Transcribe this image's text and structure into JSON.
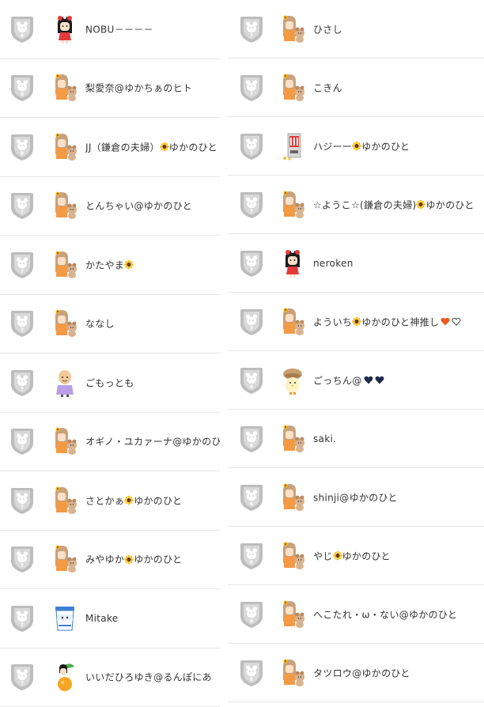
{
  "colors": {
    "badge": "#bdbdbd",
    "badge_inner": "#d9d9d9",
    "divider": "#e6e6e6",
    "text": "#333333",
    "heart_orange": "#ee5a1e",
    "heart_navy": "#1f2a4a"
  },
  "left": [
    {
      "badge": "8",
      "avatar": "girl-red-bow-avatar",
      "name": "NOBU－－－－",
      "suffix": []
    },
    {
      "badge": "8",
      "avatar": "girl-with-dog-avatar",
      "name": "梨愛奈@ゆかちぁのヒト",
      "suffix": []
    },
    {
      "badge": "8",
      "avatar": "girl-with-dog-avatar",
      "name": "JJ（鎌倉の夫婦）",
      "suffix": [
        "sunflower-icon"
      ],
      "name_after": "ゆかのひと"
    },
    {
      "badge": "7",
      "avatar": "girl-with-dog-avatar",
      "name": "とんちゃい@ゆかのひと",
      "suffix": []
    },
    {
      "badge": "7",
      "avatar": "girl-with-dog-avatar",
      "name": "かたやま",
      "suffix": [
        "sunflower-icon"
      ]
    },
    {
      "badge": "7",
      "avatar": "girl-with-dog-avatar",
      "name": "ななし",
      "suffix": []
    },
    {
      "badge": "7",
      "avatar": "bald-man-avatar",
      "name": "ごもっとも",
      "suffix": []
    },
    {
      "badge": "7",
      "avatar": "girl-with-dog-avatar",
      "name": "オギノ・ユカァーナ@ゆかのひ",
      "suffix": []
    },
    {
      "badge": "7",
      "avatar": "girl-with-dog-avatar",
      "name": "さとかぁ",
      "suffix": [
        "sunflower-icon"
      ],
      "name_after": "ゆかのひと"
    },
    {
      "badge": "7",
      "avatar": "girl-with-dog-avatar",
      "name": "みやゆか",
      "suffix": [
        "sunflower-icon"
      ],
      "name_after": "ゆかのひと"
    },
    {
      "badge": "7",
      "avatar": "yogurt-cup-avatar",
      "name": "Mitake",
      "suffix": []
    },
    {
      "badge": "7",
      "avatar": "orange-leaf-avatar",
      "name": "いいだひろゆき@るんぽにあ",
      "suffix": []
    }
  ],
  "right": [
    {
      "badge": "7",
      "avatar": "girl-with-dog-avatar",
      "name": "ひさし",
      "suffix": []
    },
    {
      "badge": "7",
      "avatar": "girl-with-dog-avatar",
      "name": "こきん",
      "suffix": []
    },
    {
      "badge": "7",
      "avatar": "vending-machine-avatar",
      "name": "ハジーー",
      "suffix": [
        "sunflower-icon"
      ],
      "name_after": "ゆかのひと"
    },
    {
      "badge": "7",
      "avatar": "girl-with-dog-avatar",
      "name": "☆ようこ☆(鎌倉の夫婦)",
      "suffix": [
        "sunflower-icon"
      ],
      "name_after": "ゆかのひと"
    },
    {
      "badge": "7",
      "avatar": "girl-red-bow-avatar",
      "name": "neroken",
      "suffix": []
    },
    {
      "badge": "7",
      "avatar": "girl-with-dog-avatar",
      "name": "よういち",
      "suffix": [
        "sunflower-icon"
      ],
      "name_after": "ゆかのひと神推し",
      "tail": [
        "heart-orange-icon",
        "heart-outline-icon"
      ]
    },
    {
      "badge": "6",
      "avatar": "mushroom-chick-avatar",
      "name": "ごっちん@",
      "suffix": [],
      "tail": [
        "heart-navy-icon",
        "heart-navy-icon"
      ]
    },
    {
      "badge": "6",
      "avatar": "girl-with-dog-avatar",
      "name": "saki.",
      "suffix": []
    },
    {
      "badge": "6",
      "avatar": "girl-with-dog-avatar",
      "name": "shinji@ゆかのひと",
      "suffix": []
    },
    {
      "badge": "6",
      "avatar": "girl-with-dog-avatar",
      "name": "やじ",
      "suffix": [
        "sunflower-icon"
      ],
      "name_after": "ゆかのひと"
    },
    {
      "badge": "6",
      "avatar": "girl-with-dog-avatar",
      "name": "へこたれ・ω・ない@ゆかのひと",
      "suffix": []
    },
    {
      "badge": "6",
      "avatar": "girl-with-dog-avatar",
      "name": "タツロウ@ゆかのひと",
      "suffix": []
    }
  ]
}
